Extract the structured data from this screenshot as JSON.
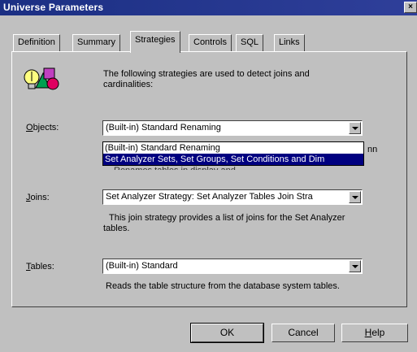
{
  "window": {
    "title": "Universe Parameters",
    "close_label": "×"
  },
  "tabs": [
    {
      "label": "Definition",
      "active": false
    },
    {
      "label": "Summary",
      "active": false
    },
    {
      "label": "Strategies",
      "active": true
    },
    {
      "label": "Controls",
      "active": false
    },
    {
      "label": "SQL",
      "active": false
    },
    {
      "label": "Links",
      "active": false
    }
  ],
  "intro": {
    "line1": "The following strategies are used to detect joins and",
    "line2": "cardinalities:"
  },
  "objects": {
    "label_first": "O",
    "label_rest": "bjects:",
    "value": "(Built-in) Standard Renaming",
    "options": [
      "(Built-in) Standard Renaming",
      "Set Analyzer Sets, Set Groups, Set Conditions and Dim"
    ],
    "peek_right": "nn",
    "peek_below": "Renames tables in display and"
  },
  "joins": {
    "label_first": "J",
    "label_rest": "oins:",
    "value": "Set Analyzer Strategy: Set Analyzer Tables Join Stra",
    "desc1": "This join strategy provides a list of joins for the Set Analyzer",
    "desc2": "tables."
  },
  "tables": {
    "label_first": "T",
    "label_rest": "ables:",
    "value": "(Built-in) Standard",
    "desc": "Reads the table structure from the database system tables."
  },
  "buttons": {
    "ok": "OK",
    "cancel": "Cancel",
    "help_first": "H",
    "help_rest": "elp"
  }
}
